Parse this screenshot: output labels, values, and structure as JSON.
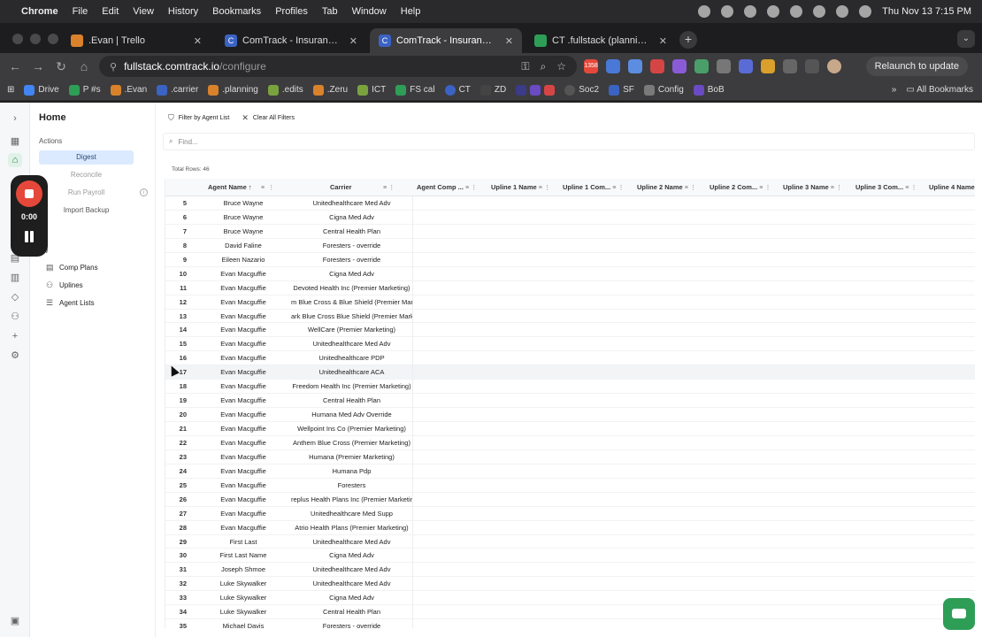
{
  "menubar": {
    "app": "Chrome",
    "items": [
      "File",
      "Edit",
      "View",
      "History",
      "Bookmarks",
      "Profiles",
      "Tab",
      "Window",
      "Help"
    ],
    "clock": "Thu Nov 13  7:15 PM"
  },
  "tabs": [
    {
      "title": ".Evan | Trello",
      "favicon_color": "#d9822b"
    },
    {
      "title": "ComTrack - Insurance Comm",
      "favicon_color": "#3b63c4"
    },
    {
      "title": "ComTrack - Insurance Comm",
      "favicon_color": "#3b63c4",
      "active": true
    },
    {
      "title": "CT .fullstack (planning) | Trel",
      "favicon_color": "#2e9e57"
    }
  ],
  "toolbar": {
    "url_host": "fullstack.comtrack.io",
    "url_path": "/configure",
    "relaunch_label": "Relaunch to update",
    "badge": "1358"
  },
  "bookmarks": {
    "items": [
      {
        "label": "Drive",
        "color": "#4285f4"
      },
      {
        "label": "P #s",
        "color": "#2e9e57"
      },
      {
        "label": ".Evan",
        "color": "#d9822b"
      },
      {
        "label": ".carrier",
        "color": "#3b63c4"
      },
      {
        "label": ".planning",
        "color": "#d9822b"
      },
      {
        "label": ".edits",
        "color": "#7aa33f"
      },
      {
        "label": ".Zeru",
        "color": "#d9822b"
      },
      {
        "label": "ICT",
        "color": "#7aa33f"
      },
      {
        "label": "FS cal",
        "color": "#2e9e57"
      },
      {
        "label": "CT",
        "color": "#3b63c4"
      },
      {
        "label": "ZD",
        "color": "#444444"
      },
      {
        "label": "SF",
        "color": "#3b63c4"
      },
      {
        "label": "Config",
        "color": "#7a7a7a"
      },
      {
        "label": "Soc2",
        "color": "#555555"
      },
      {
        "label": "BoB",
        "color": "#6a4bc4"
      }
    ],
    "all_label": "All Bookmarks"
  },
  "sidenav": {
    "home": "Home",
    "actions_label": "Actions",
    "digest": "Digest",
    "reconcile": "Reconcile",
    "run_payroll": "Run Payroll",
    "import_backup": "Import Backup",
    "view_label": "ew",
    "comp_plans": "Comp Plans",
    "uplines": "Uplines",
    "agent_lists": "Agent Lists"
  },
  "recorder": {
    "time": "0:00"
  },
  "filters": {
    "filter_by_agent_list": "Filter by Agent List",
    "clear_all": "Clear All Filters",
    "find_placeholder": "Find...",
    "total_rows": "Total Rows: 46"
  },
  "columns": [
    {
      "label": "Agent Name ↑"
    },
    {
      "label": "Carrier"
    },
    {
      "label": "Agent Comp ..."
    },
    {
      "label": "Upline 1 Name"
    },
    {
      "label": "Upline 1 Com..."
    },
    {
      "label": "Upline 2 Name"
    },
    {
      "label": "Upline 2 Com..."
    },
    {
      "label": "Upline 3 Name"
    },
    {
      "label": "Upline 3 Com..."
    },
    {
      "label": "Upline 4 Name"
    }
  ],
  "rows": [
    {
      "n": "5",
      "agent": "Bruce Wayne",
      "carrier": "Unitedhealthcare Med Adv"
    },
    {
      "n": "6",
      "agent": "Bruce Wayne",
      "carrier": "Cigna Med Adv"
    },
    {
      "n": "7",
      "agent": "Bruce Wayne",
      "carrier": "Central Health Plan"
    },
    {
      "n": "8",
      "agent": "David Faline",
      "carrier": "Foresters - override"
    },
    {
      "n": "9",
      "agent": "Eileen Nazario",
      "carrier": "Foresters - override"
    },
    {
      "n": "10",
      "agent": "Evan Macguffie",
      "carrier": "Cigna Med Adv"
    },
    {
      "n": "11",
      "agent": "Evan Macguffie",
      "carrier": "Devoted Health Inc (Premier Marketing)"
    },
    {
      "n": "12",
      "agent": "Evan Macguffie",
      "carrier": "m Blue Cross & Blue Shield (Premier Mark"
    },
    {
      "n": "13",
      "agent": "Evan Macguffie",
      "carrier": "ark Blue Cross Blue Shield (Premier Mark"
    },
    {
      "n": "14",
      "agent": "Evan Macguffie",
      "carrier": "WellCare (Premier Marketing)"
    },
    {
      "n": "15",
      "agent": "Evan Macguffie",
      "carrier": "Unitedhealthcare Med Adv"
    },
    {
      "n": "16",
      "agent": "Evan Macguffie",
      "carrier": "Unitedhealthcare PDP"
    },
    {
      "n": "17",
      "agent": "Evan Macguffie",
      "carrier": "Unitedhealthcare ACA",
      "hover": true
    },
    {
      "n": "18",
      "agent": "Evan Macguffie",
      "carrier": "Freedom Health Inc (Premier Marketing)"
    },
    {
      "n": "19",
      "agent": "Evan Macguffie",
      "carrier": "Central Health Plan"
    },
    {
      "n": "20",
      "agent": "Evan Macguffie",
      "carrier": "Humana Med Adv Override"
    },
    {
      "n": "21",
      "agent": "Evan Macguffie",
      "carrier": "Wellpoint Ins Co (Premier Marketing)"
    },
    {
      "n": "22",
      "agent": "Evan Macguffie",
      "carrier": "Anthem Blue Cross (Premier Marketing)"
    },
    {
      "n": "23",
      "agent": "Evan Macguffie",
      "carrier": "Humana (Premier Marketing)"
    },
    {
      "n": "24",
      "agent": "Evan Macguffie",
      "carrier": "Humana Pdp"
    },
    {
      "n": "25",
      "agent": "Evan Macguffie",
      "carrier": "Foresters"
    },
    {
      "n": "26",
      "agent": "Evan Macguffie",
      "carrier": "replus Health Plans Inc (Premier Marketin"
    },
    {
      "n": "27",
      "agent": "Evan Macguffie",
      "carrier": "Unitedhealthcare Med Supp"
    },
    {
      "n": "28",
      "agent": "Evan Macguffie",
      "carrier": "Atrio Health Plans (Premier Marketing)"
    },
    {
      "n": "29",
      "agent": "First Last",
      "carrier": "Unitedhealthcare Med Adv"
    },
    {
      "n": "30",
      "agent": "First Last Name",
      "carrier": "Cigna Med Adv"
    },
    {
      "n": "31",
      "agent": "Joseph Shmoe",
      "carrier": "Unitedhealthcare Med Adv"
    },
    {
      "n": "32",
      "agent": "Luke Skywalker",
      "carrier": "Unitedhealthcare Med Adv"
    },
    {
      "n": "33",
      "agent": "Luke Skywalker",
      "carrier": "Cigna Med Adv"
    },
    {
      "n": "34",
      "agent": "Luke Skywalker",
      "carrier": "Central Health Plan"
    },
    {
      "n": "35",
      "agent": "Michael Davis",
      "carrier": "Foresters - override"
    }
  ]
}
